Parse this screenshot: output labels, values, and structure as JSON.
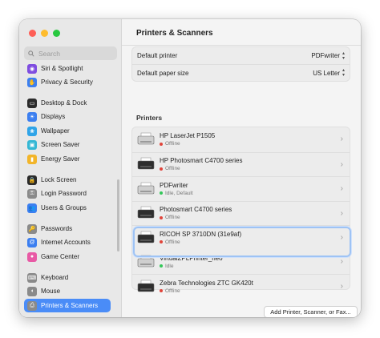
{
  "search": {
    "placeholder": "Search"
  },
  "sidebar": {
    "items": [
      {
        "label": "Siri & Spotlight",
        "icon": "siri-icon",
        "color": "#7f4de0"
      },
      {
        "label": "Privacy & Security",
        "icon": "hand-icon",
        "color": "#3c7ff0"
      },
      {
        "label": "Desktop & Dock",
        "icon": "dock-icon",
        "color": "#2b2b2b"
      },
      {
        "label": "Displays",
        "icon": "display-icon",
        "color": "#3c7ff0"
      },
      {
        "label": "Wallpaper",
        "icon": "wallpaper-icon",
        "color": "#2fa4e8"
      },
      {
        "label": "Screen Saver",
        "icon": "screensaver-icon",
        "color": "#35b7d4"
      },
      {
        "label": "Energy Saver",
        "icon": "battery-icon",
        "color": "#f2b52a"
      },
      {
        "label": "Lock Screen",
        "icon": "lock-icon",
        "color": "#2b2b2b"
      },
      {
        "label": "Login Password",
        "icon": "key-icon",
        "color": "#8a8a8a"
      },
      {
        "label": "Users & Groups",
        "icon": "users-icon",
        "color": "#3c7ff0"
      },
      {
        "label": "Passwords",
        "icon": "passwords-icon",
        "color": "#8a8a8a"
      },
      {
        "label": "Internet Accounts",
        "icon": "at-icon",
        "color": "#3c7ff0"
      },
      {
        "label": "Game Center",
        "icon": "game-center-icon",
        "color": "#e85aa5"
      },
      {
        "label": "Keyboard",
        "icon": "keyboard-icon",
        "color": "#8a8a8a"
      },
      {
        "label": "Mouse",
        "icon": "mouse-icon",
        "color": "#8a8a8a"
      },
      {
        "label": "Printers & Scanners",
        "icon": "printer-icon",
        "color": "#8a8a8a"
      }
    ]
  },
  "main": {
    "title": "Printers & Scanners",
    "default_printer": {
      "label": "Default printer",
      "value": "PDFwriter"
    },
    "default_paper": {
      "label": "Default paper size",
      "value": "US Letter"
    },
    "printers_heading": "Printers",
    "printers": [
      {
        "name": "HP LaserJet P1505",
        "status": "Offline",
        "state": "offline"
      },
      {
        "name": "HP Photosmart C4700 series",
        "status": "Offline",
        "state": "offline"
      },
      {
        "name": "PDFwriter",
        "status": "Idle, Default",
        "state": "idle"
      },
      {
        "name": "Photosmart C4700 series",
        "status": "Offline",
        "state": "offline"
      },
      {
        "name": "RICOH SP 3710DN (31e9af)",
        "status": "Offline",
        "state": "offline"
      },
      {
        "name": "VirtualZPLPrinter_neo",
        "status": "Idle",
        "state": "idle",
        "selected": true
      },
      {
        "name": "Zebra Technologies ZTC GK420t",
        "status": "Offline",
        "state": "offline"
      }
    ],
    "add_button": "Add Printer, Scanner, or Fax...",
    "help_button": "?"
  }
}
